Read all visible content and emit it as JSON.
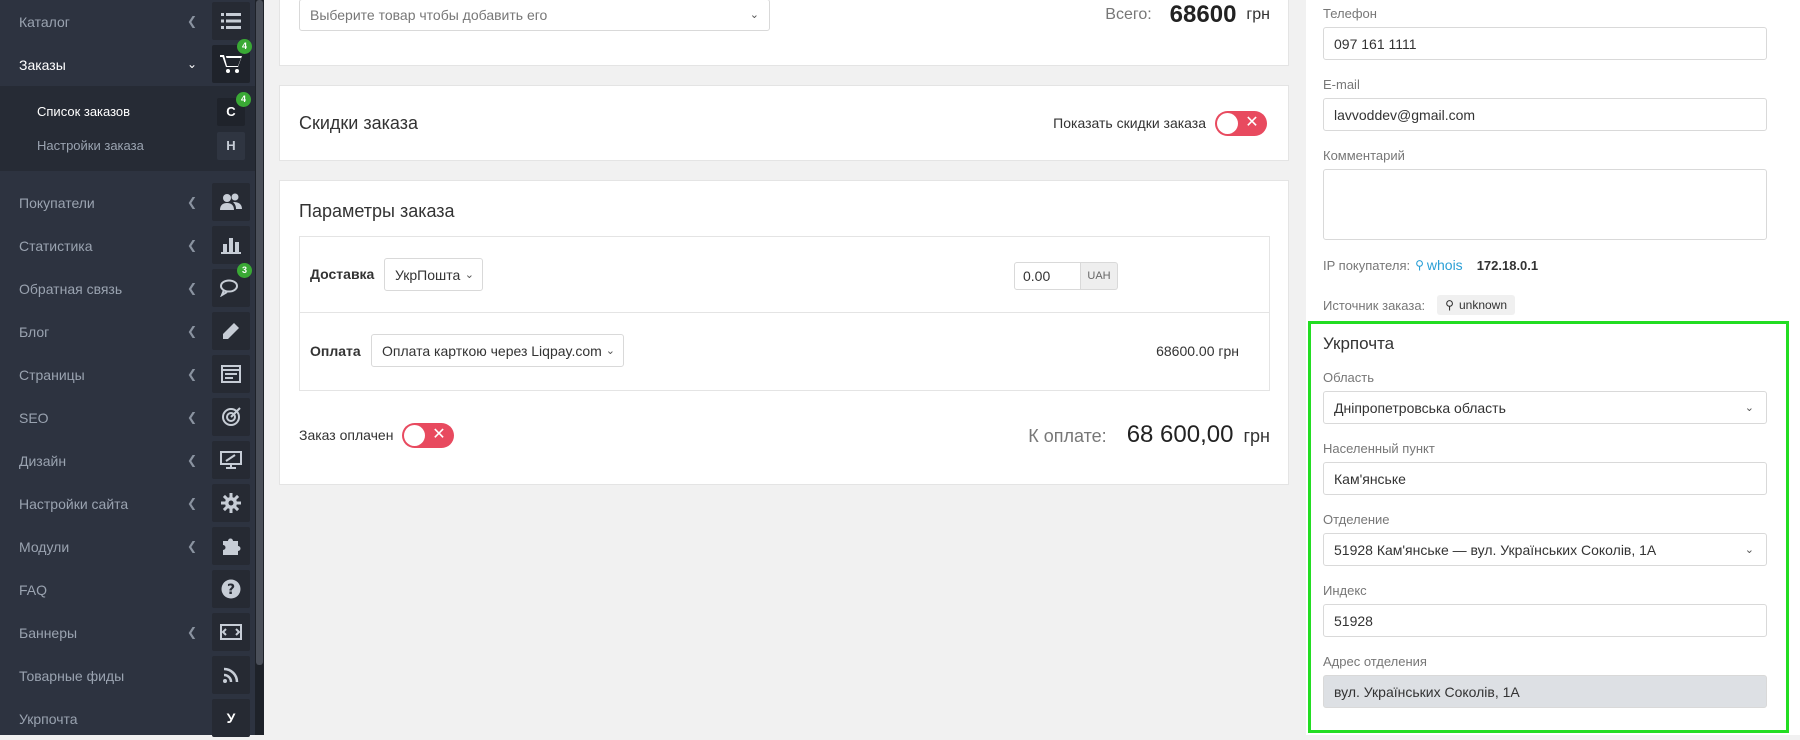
{
  "sidebar": {
    "items": [
      {
        "label": "Каталог",
        "icon": "list-icon"
      },
      {
        "label": "Заказы",
        "icon": "cart-icon",
        "badge": "4"
      },
      {
        "label": "Покупатели",
        "icon": "users-icon"
      },
      {
        "label": "Статистика",
        "icon": "bar-chart-icon"
      },
      {
        "label": "Обратная связь",
        "icon": "comments-icon",
        "badge": "3"
      },
      {
        "label": "Блог",
        "icon": "pencil-icon"
      },
      {
        "label": "Страницы",
        "icon": "pages-icon"
      },
      {
        "label": "SEO",
        "icon": "target-icon"
      },
      {
        "label": "Дизайн",
        "icon": "monitor-brush-icon"
      },
      {
        "label": "Настройки сайта",
        "icon": "gear-icon"
      },
      {
        "label": "Модули",
        "icon": "puzzle-icon"
      },
      {
        "label": "FAQ",
        "icon": "question-icon"
      },
      {
        "label": "Баннеры",
        "icon": "banner-icon"
      },
      {
        "label": "Товарные фиды",
        "icon": "rss-icon"
      },
      {
        "label": "Укрпочта",
        "icon": "letter-u-icon",
        "letter": "У"
      }
    ],
    "submenu": [
      {
        "label": "Список заказов",
        "letter": "С",
        "badge": "4"
      },
      {
        "label": "Настройки заказа",
        "letter": "Н"
      }
    ]
  },
  "products": {
    "select_placeholder": "Выберите товар чтобы добавить его",
    "total_label": "Всего:",
    "total_value": "68600",
    "currency": "грн"
  },
  "discounts": {
    "title": "Скидки заказа",
    "toggle_label": "Показать скидки заказа"
  },
  "params": {
    "title": "Параметры заказа",
    "delivery_label": "Доставка",
    "delivery_value": "УкрПошта",
    "delivery_price": "0.00",
    "delivery_currency": "UAH",
    "payment_label": "Оплата",
    "payment_value": "Оплата карткою через Liqpay.com",
    "payment_amount": "68600.00 грн",
    "paid_label": "Заказ оплачен",
    "to_pay_label": "К оплате:",
    "to_pay_value": "68 600,00",
    "to_pay_currency": "грн"
  },
  "customer": {
    "phone_label": "Телефон",
    "phone_value": "097 161 1111",
    "email_label": "E-mail",
    "email_value": "lavvoddev@gmail.com",
    "comment_label": "Комментарий",
    "comment_value": "",
    "ip_label": "IP покупателя:",
    "whois_label": "whois",
    "ip_value": "172.18.0.1",
    "source_label": "Источник заказа:",
    "source_value": "unknown"
  },
  "ukrposhta": {
    "title": "Укрпочта",
    "region_label": "Область",
    "region_value": "Дніпропетровська область",
    "city_label": "Населенный пункт",
    "city_value": "Кам'янське",
    "branch_label": "Отделение",
    "branch_value": "51928 Кам'янське — вул. Українських Соколів, 1А",
    "index_label": "Индекс",
    "index_value": "51928",
    "address_label": "Адрес отделения",
    "address_value": "вул. Українських Соколів, 1А"
  },
  "colors": {
    "sidebar_bg": "#2d3340",
    "toggle_off": "#e84a5f",
    "badge": "#3aa935",
    "highlight": "#22dd22",
    "link": "#2a9fd6"
  }
}
